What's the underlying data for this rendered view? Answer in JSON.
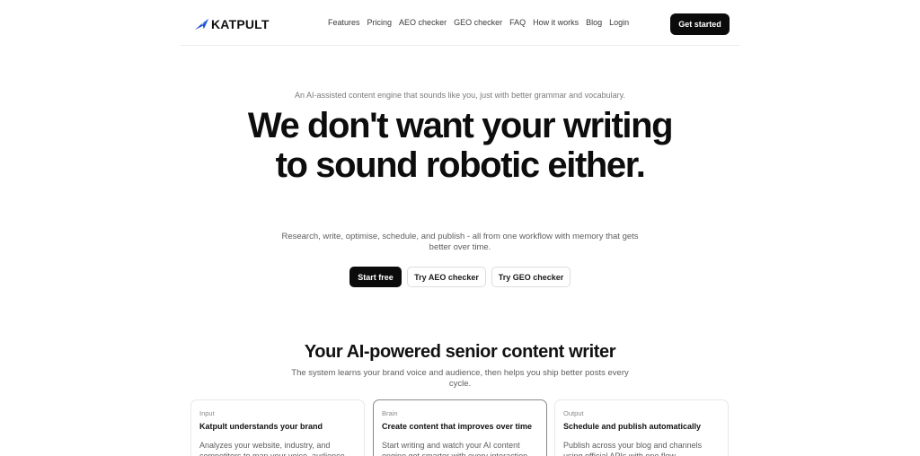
{
  "brand": {
    "name": "KATPULT",
    "accent": "#2563eb"
  },
  "nav": {
    "items": [
      "Features",
      "Pricing",
      "AEO checker",
      "GEO checker",
      "FAQ",
      "How it works",
      "Blog",
      "Login"
    ],
    "cta": "Get started"
  },
  "hero": {
    "tagline": "An AI-assisted content engine that sounds like you, just with better grammar and vocabulary.",
    "headline": "We don't want your writing to sound robotic either.",
    "subtext": "Research, write, optimise, schedule, and publish - all from one workflow with memory that gets better over time.",
    "buttons": {
      "primary": "Start free",
      "aeo": "Try AEO checker",
      "geo": "Try GEO checker"
    }
  },
  "section": {
    "title": "Your AI-powered senior content writer",
    "subtitle": "The system learns your brand voice and audience, then helps you ship better posts every cycle."
  },
  "cards": [
    {
      "kicker": "Input",
      "title": "Katpult understands your brand",
      "desc": "Analyzes your website, industry, and competitors to map your voice, audience,"
    },
    {
      "kicker": "Brain",
      "title": "Create content that improves over time",
      "desc": "Start writing and watch your AI content engine get smarter with every interaction."
    },
    {
      "kicker": "Output",
      "title": "Schedule and publish automatically",
      "desc": "Publish across your blog and channels using official APIs with one flow."
    }
  ]
}
